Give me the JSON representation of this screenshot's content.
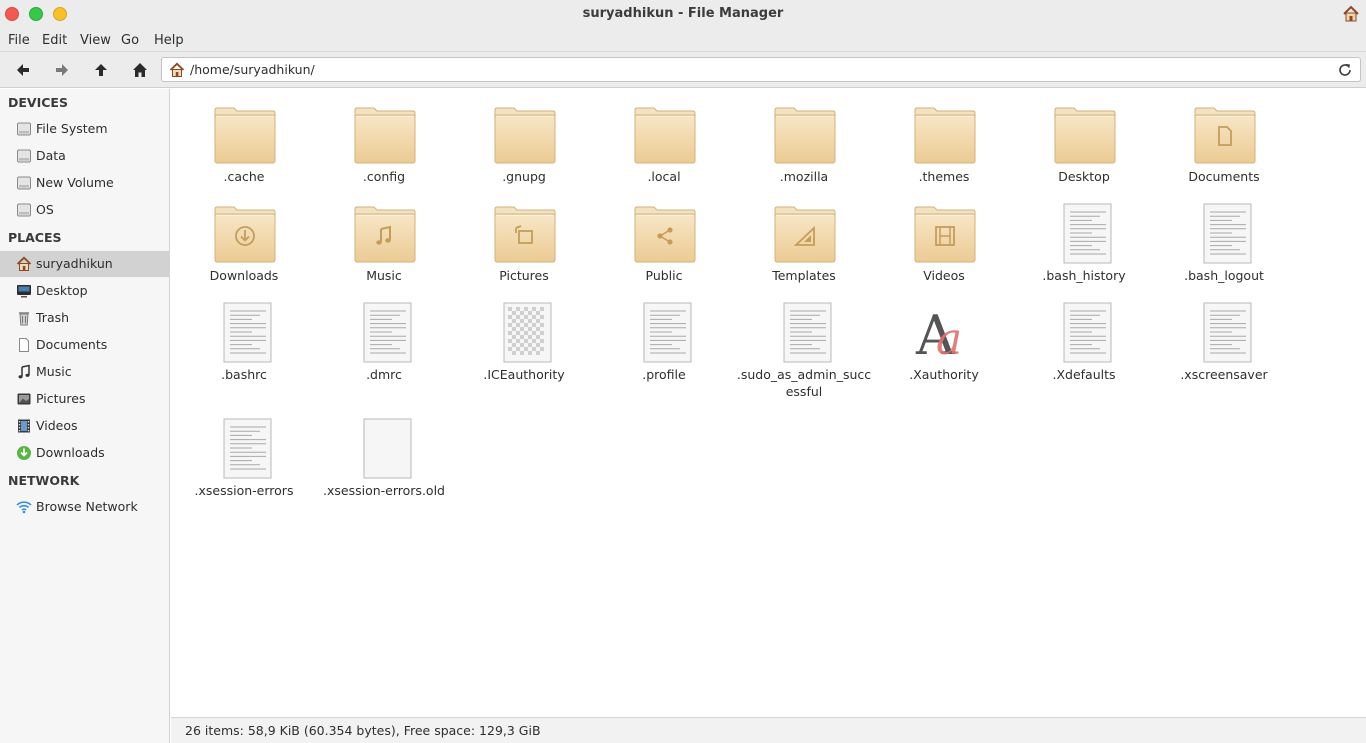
{
  "window": {
    "title": "suryadhikun - File Manager"
  },
  "menu": [
    "File",
    "Edit",
    "View",
    "Go",
    "Help"
  ],
  "address": {
    "path": "/home/suryadhikun/"
  },
  "sidebar": {
    "devices_header": "DEVICES",
    "devices": [
      "File System",
      "Data",
      "New Volume",
      "OS"
    ],
    "places_header": "PLACES",
    "places": [
      "suryadhikun",
      "Desktop",
      "Trash",
      "Documents",
      "Music",
      "Pictures",
      "Videos",
      "Downloads"
    ],
    "network_header": "NETWORK",
    "network": [
      "Browse Network"
    ]
  },
  "files": [
    {
      "name": ".cache",
      "kind": "folder"
    },
    {
      "name": ".config",
      "kind": "folder"
    },
    {
      "name": ".gnupg",
      "kind": "folder"
    },
    {
      "name": ".local",
      "kind": "folder"
    },
    {
      "name": ".mozilla",
      "kind": "folder"
    },
    {
      "name": ".themes",
      "kind": "folder"
    },
    {
      "name": "Desktop",
      "kind": "folder-desktop"
    },
    {
      "name": "Documents",
      "kind": "folder-documents"
    },
    {
      "name": "Downloads",
      "kind": "folder-downloads"
    },
    {
      "name": "Music",
      "kind": "folder-music"
    },
    {
      "name": "Pictures",
      "kind": "folder-pictures"
    },
    {
      "name": "Public",
      "kind": "folder-public"
    },
    {
      "name": "Templates",
      "kind": "folder-templates"
    },
    {
      "name": "Videos",
      "kind": "folder-videos"
    },
    {
      "name": ".bash_history",
      "kind": "text"
    },
    {
      "name": ".bash_logout",
      "kind": "text"
    },
    {
      "name": ".bashrc",
      "kind": "text"
    },
    {
      "name": ".dmrc",
      "kind": "text"
    },
    {
      "name": ".ICEauthority",
      "kind": "binary"
    },
    {
      "name": ".profile",
      "kind": "text"
    },
    {
      "name": ".sudo_as_admin_successful",
      "kind": "text"
    },
    {
      "name": ".Xauthority",
      "kind": "font"
    },
    {
      "name": ".Xdefaults",
      "kind": "text"
    },
    {
      "name": ".xscreensaver",
      "kind": "text"
    },
    {
      "name": ".xsession-errors",
      "kind": "text"
    },
    {
      "name": ".xsession-errors.old",
      "kind": "empty"
    }
  ],
  "status": {
    "text": "26 items: 58,9 KiB (60.354 bytes), Free space: 129,3 GiB"
  }
}
